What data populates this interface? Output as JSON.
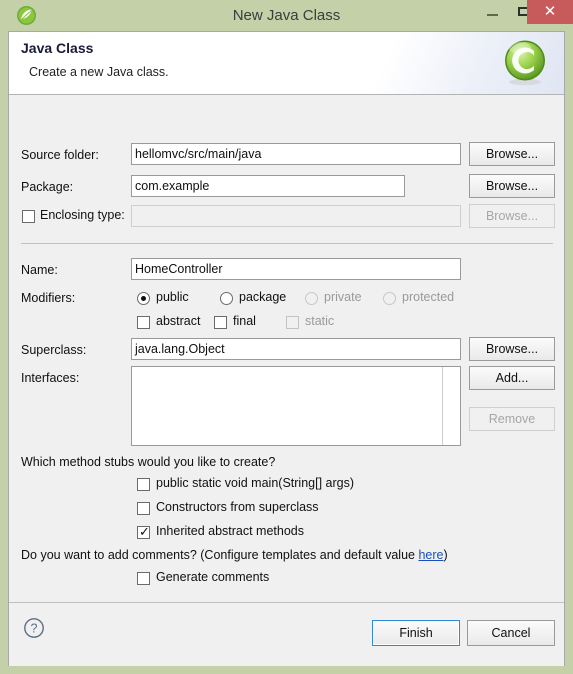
{
  "window": {
    "title": "New Java Class",
    "icon": "spring-leaf-icon",
    "controls": {
      "minimize": "minimize-icon",
      "maximize": "maximize-icon",
      "close_glyph": "✕",
      "close_color": "#c75b5b"
    },
    "frame_color": "#c3d0a8",
    "titlebar_color": "#c3d0a8"
  },
  "header": {
    "title": "Java Class",
    "subtitle": "Create a new Java class.",
    "logo": "java-class-green-c-icon",
    "logo_letter": "C",
    "logo_color": "#7cc142"
  },
  "form": {
    "source_folder": {
      "label": "Source folder:",
      "value": "hellomvc/src/main/java",
      "browse_label": "Browse...",
      "browse_enabled": true
    },
    "package": {
      "label": "Package:",
      "value": "com.example",
      "browse_label": "Browse...",
      "browse_enabled": true
    },
    "enclosing_type": {
      "label": "Enclosing type:",
      "checked": false,
      "value": "",
      "browse_label": "Browse...",
      "browse_enabled": false
    },
    "name": {
      "label": "Name:",
      "value": "HomeController"
    },
    "modifiers": {
      "label": "Modifiers:",
      "access": [
        {
          "label": "public",
          "selected": true,
          "enabled": true
        },
        {
          "label": "package",
          "selected": false,
          "enabled": true
        },
        {
          "label": "private",
          "selected": false,
          "enabled": false
        },
        {
          "label": "protected",
          "selected": false,
          "enabled": false
        }
      ],
      "flags": [
        {
          "label": "abstract",
          "checked": false,
          "enabled": true
        },
        {
          "label": "final",
          "checked": false,
          "enabled": true
        },
        {
          "label": "static",
          "checked": false,
          "enabled": false
        }
      ]
    },
    "superclass": {
      "label": "Superclass:",
      "value": "java.lang.Object",
      "browse_label": "Browse...",
      "browse_enabled": true
    },
    "interfaces": {
      "label": "Interfaces:",
      "items": [],
      "add_label": "Add...",
      "remove_label": "Remove",
      "remove_enabled": false
    }
  },
  "stubs": {
    "question": "Which method stubs would you like to create?",
    "options": [
      {
        "label": "public static void main(String[] args)",
        "checked": false
      },
      {
        "label": "Constructors from superclass",
        "checked": false
      },
      {
        "label": "Inherited abstract methods",
        "checked": true
      }
    ]
  },
  "comments": {
    "question_prefix": "Do you want to add comments? (Configure templates and default value ",
    "link_text": "here",
    "question_suffix": ")",
    "link_color": "#1a4fbf",
    "option": {
      "label": "Generate comments",
      "checked": false
    }
  },
  "footer": {
    "help_icon": "help-question-icon",
    "finish_label": "Finish",
    "cancel_label": "Cancel",
    "focused_button": "Finish",
    "focus_color": "#2f89d6"
  }
}
